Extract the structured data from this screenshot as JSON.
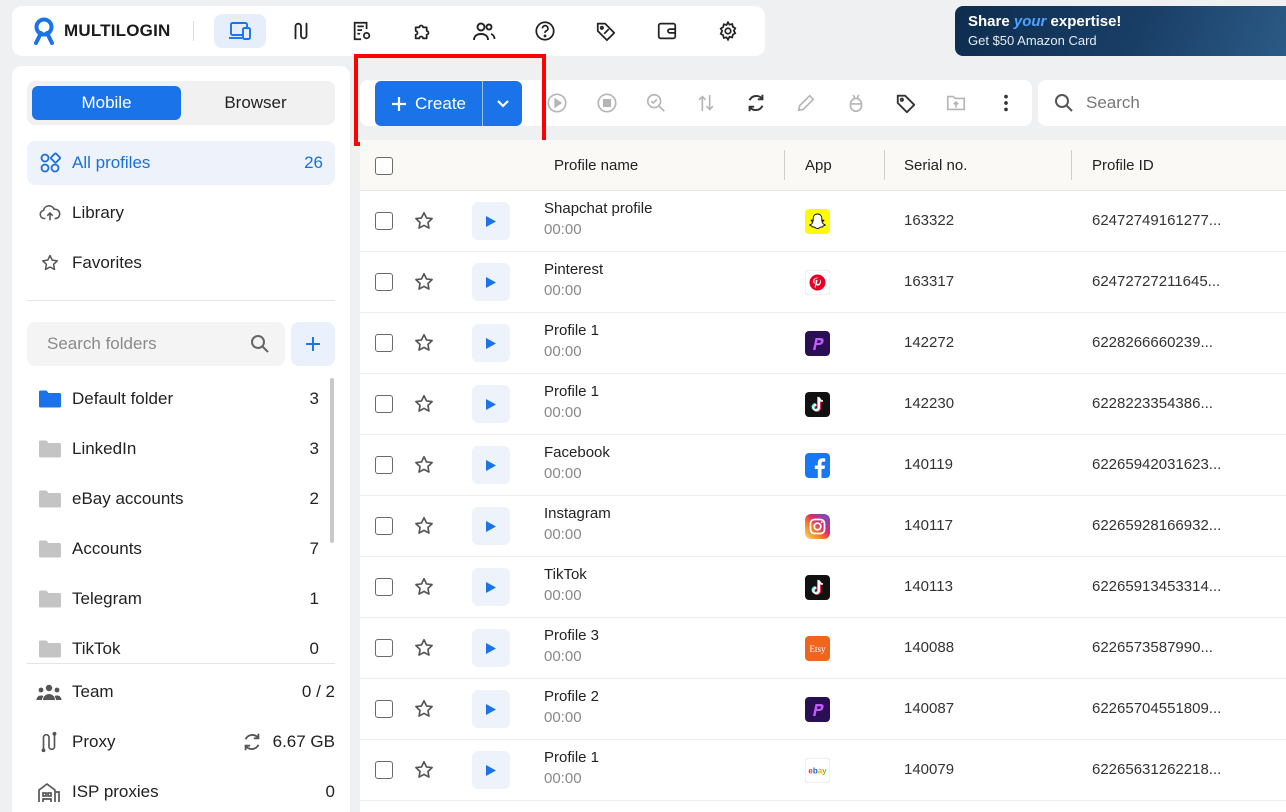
{
  "brand": {
    "name": "MULTILOGIN"
  },
  "nav": {
    "icons": [
      "devices-icon",
      "proxy-route-icon",
      "document-settings-icon",
      "puzzle-icon",
      "team-icon",
      "help-icon",
      "tag-icon",
      "wallet-icon",
      "gear-icon"
    ],
    "active_index": 0
  },
  "promo": {
    "title_pre": "Share ",
    "title_em": "your",
    "title_post": " expertise!",
    "subtitle": "Get $50 Amazon Card"
  },
  "sidebar": {
    "tabs": [
      "Mobile",
      "Browser"
    ],
    "active_tab": "Mobile",
    "all_profiles": {
      "label": "All profiles",
      "count": "26"
    },
    "library": {
      "label": "Library"
    },
    "favorites": {
      "label": "Favorites"
    },
    "folder_search_placeholder": "Search folders",
    "folders": [
      {
        "name": "Default folder",
        "count": "3",
        "color": "#1a73e8"
      },
      {
        "name": "LinkedIn",
        "count": "3",
        "color": "#c4c4c4"
      },
      {
        "name": "eBay accounts",
        "count": "2",
        "color": "#c4c4c4"
      },
      {
        "name": "Accounts",
        "count": "7",
        "color": "#c4c4c4"
      },
      {
        "name": "Telegram",
        "count": "1",
        "color": "#c4c4c4"
      },
      {
        "name": "TikTok",
        "count": "0",
        "color": "#c4c4c4"
      }
    ],
    "team": {
      "label": "Team",
      "value": "0 / 2"
    },
    "proxy": {
      "label": "Proxy",
      "value": "6.67 GB"
    },
    "isp": {
      "label": "ISP proxies",
      "value": "0"
    }
  },
  "toolbar": {
    "create_label": "Create",
    "search_placeholder": "Search",
    "tools": [
      "play-icon",
      "stop-icon",
      "zoom-check-icon",
      "transfer-icon",
      "refresh-icon",
      "edit-pencil-icon",
      "cookie-robot-icon",
      "tag-icon",
      "folder-move-icon",
      "more-vertical-icon"
    ]
  },
  "table": {
    "headers": {
      "name": "Profile name",
      "app": "App",
      "serial": "Serial no.",
      "id": "Profile ID"
    },
    "rows": [
      {
        "name": "Shapchat profile",
        "time": "00:00",
        "app": "snapchat",
        "serial": "163322",
        "id": "62472749161277..."
      },
      {
        "name": "Pinterest",
        "time": "00:00",
        "app": "pinterest",
        "serial": "163317",
        "id": "62472727211645..."
      },
      {
        "name": "Profile 1",
        "time": "00:00",
        "app": "purple-p",
        "serial": "142272",
        "id": "6228266660239..."
      },
      {
        "name": "Profile 1",
        "time": "00:00",
        "app": "tiktok",
        "serial": "142230",
        "id": "6228223354386..."
      },
      {
        "name": "Facebook",
        "time": "00:00",
        "app": "facebook",
        "serial": "140119",
        "id": "62265942031623..."
      },
      {
        "name": "Instagram",
        "time": "00:00",
        "app": "instagram",
        "serial": "140117",
        "id": "62265928166932..."
      },
      {
        "name": "TikTok",
        "time": "00:00",
        "app": "tiktok",
        "serial": "140113",
        "id": "62265913453314..."
      },
      {
        "name": "Profile 3",
        "time": "00:00",
        "app": "etsy",
        "serial": "140088",
        "id": "6226573587990..."
      },
      {
        "name": "Profile 2",
        "time": "00:00",
        "app": "purple-p",
        "serial": "140087",
        "id": "62265704551809..."
      },
      {
        "name": "Profile 1",
        "time": "00:00",
        "app": "ebay",
        "serial": "140079",
        "id": "62265631262218..."
      }
    ]
  },
  "app_icon_text": {
    "etsy": "Etsy",
    "ebay": "ebay"
  },
  "colors": {
    "accent": "#1a73e8",
    "highlight": "#ff0000"
  }
}
